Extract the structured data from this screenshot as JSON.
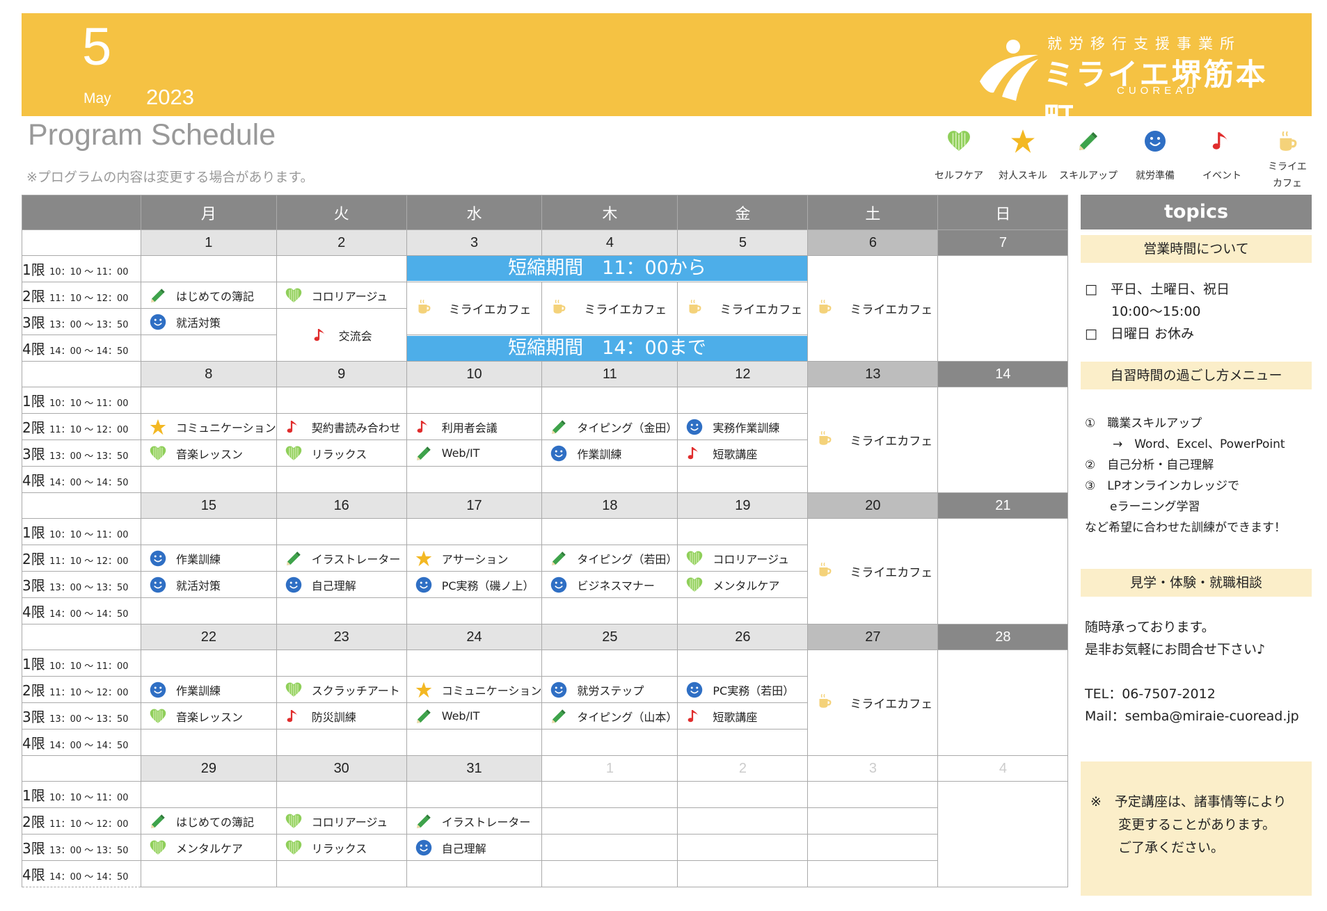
{
  "header": {
    "month_number": "5",
    "month_name": "May",
    "year": "2023",
    "logo": {
      "sub": "就労移行支援事業所",
      "main": "ミライエ堺筋本町",
      "roman": "CUOREAD"
    }
  },
  "title": "Program Schedule",
  "note": "※プログラムの内容は変更する場合があります。",
  "legend": [
    {
      "icon": "heart-icon",
      "label": "セルフケア"
    },
    {
      "icon": "star-icon",
      "label": "対人スキル"
    },
    {
      "icon": "pencil-icon",
      "label": "スキルアップ"
    },
    {
      "icon": "smiley-icon",
      "label": "就労準備"
    },
    {
      "icon": "music-note-icon",
      "label": "イベント"
    },
    {
      "icon": "cup-icon",
      "label_line1": "ミライエ",
      "label_line2": "カフェ"
    }
  ],
  "weekdays": [
    "月",
    "火",
    "水",
    "木",
    "金",
    "土",
    "日"
  ],
  "periods": [
    {
      "name": "1限",
      "time": "10：10 〜 11：00"
    },
    {
      "name": "2限",
      "time": "11：10 〜 12：00"
    },
    {
      "name": "3限",
      "time": "13：00 〜 13：50"
    },
    {
      "name": "4限",
      "time": "14：00 〜 14：50"
    }
  ],
  "cafe_label": "ミライエカフェ",
  "bands": {
    "top": "短縮期間　11：00から",
    "bottom": "短縮期間　14：00まで"
  },
  "weeks": [
    {
      "dates": [
        "1",
        "2",
        "3",
        "4",
        "5",
        "6",
        "7"
      ]
    },
    {
      "dates": [
        "8",
        "9",
        "10",
        "11",
        "12",
        "13",
        "14"
      ]
    },
    {
      "dates": [
        "15",
        "16",
        "17",
        "18",
        "19",
        "20",
        "21"
      ]
    },
    {
      "dates": [
        "22",
        "23",
        "24",
        "25",
        "26",
        "27",
        "28"
      ]
    },
    {
      "dates": [
        "29",
        "30",
        "31",
        "1",
        "2",
        "3",
        "4"
      ]
    }
  ],
  "week1": {
    "mon": [
      {
        "icon": "pencil-icon",
        "label": "はじめての簿記"
      },
      {
        "icon": "smiley-icon",
        "label": "就活対策"
      }
    ],
    "tue_p2": {
      "icon": "heart-icon",
      "label": "コロリアージュ"
    },
    "tue_p34": {
      "icon": "music-note-icon",
      "label": "交流会"
    }
  },
  "week2": {
    "p2": [
      {
        "icon": "star-icon",
        "label": "コミュニケーション"
      },
      {
        "icon": "music-note-icon",
        "label": "契約書読み合わせ"
      },
      {
        "icon": "music-note-icon",
        "label": "利用者会議"
      },
      {
        "icon": "pencil-icon",
        "label": "タイピング（金田）"
      },
      {
        "icon": "smiley-icon",
        "label": "実務作業訓練"
      }
    ],
    "p3": [
      {
        "icon": "heart-icon",
        "label": "音楽レッスン"
      },
      {
        "icon": "heart-icon",
        "label": "リラックス"
      },
      {
        "icon": "pencil-icon",
        "label": "Web/IT"
      },
      {
        "icon": "smiley-icon",
        "label": "作業訓練"
      },
      {
        "icon": "music-note-icon",
        "label": "短歌講座"
      }
    ]
  },
  "week3": {
    "p2": [
      {
        "icon": "smiley-icon",
        "label": "作業訓練"
      },
      {
        "icon": "pencil-icon",
        "label": "イラストレーター"
      },
      {
        "icon": "star-icon",
        "label": "アサーション"
      },
      {
        "icon": "pencil-icon",
        "label": "タイピング（若田）"
      },
      {
        "icon": "heart-icon",
        "label": "コロリアージュ"
      }
    ],
    "p3": [
      {
        "icon": "smiley-icon",
        "label": "就活対策"
      },
      {
        "icon": "smiley-icon",
        "label": "自己理解"
      },
      {
        "icon": "smiley-icon",
        "label": "PC実務（磯ノ上）"
      },
      {
        "icon": "smiley-icon",
        "label": "ビジネスマナー"
      },
      {
        "icon": "heart-icon",
        "label": "メンタルケア"
      }
    ]
  },
  "week4": {
    "p2": [
      {
        "icon": "smiley-icon",
        "label": "作業訓練"
      },
      {
        "icon": "heart-icon",
        "label": "スクラッチアート"
      },
      {
        "icon": "star-icon",
        "label": "コミュニケーション"
      },
      {
        "icon": "smiley-icon",
        "label": "就労ステップ"
      },
      {
        "icon": "smiley-icon",
        "label": "PC実務（若田）"
      }
    ],
    "p3": [
      {
        "icon": "heart-icon",
        "label": "音楽レッスン"
      },
      {
        "icon": "music-note-icon",
        "label": "防災訓練"
      },
      {
        "icon": "pencil-icon",
        "label": "Web/IT"
      },
      {
        "icon": "pencil-icon",
        "label": "タイピング（山本）"
      },
      {
        "icon": "music-note-icon",
        "label": "短歌講座"
      }
    ]
  },
  "week5": {
    "p2": [
      {
        "icon": "pencil-icon",
        "label": "はじめての簿記"
      },
      {
        "icon": "heart-icon",
        "label": "コロリアージュ"
      },
      {
        "icon": "pencil-icon",
        "label": "イラストレーター"
      }
    ],
    "p3": [
      {
        "icon": "heart-icon",
        "label": "メンタルケア"
      },
      {
        "icon": "heart-icon",
        "label": "リラックス"
      },
      {
        "icon": "smiley-icon",
        "label": "自己理解"
      }
    ]
  },
  "topics": {
    "title": "topics",
    "sec1": {
      "title": "営業時間について",
      "line1": "□　平日、土曜日、祝日",
      "line2": "10:00〜15:00",
      "line3": "□　日曜日 お休み"
    },
    "sec2": {
      "title": "自習時間の過ごし方メニュー",
      "line1": "①　職業スキルアップ",
      "line2": "→　Word、Excel、PowerPoint",
      "line3": "②　自己分析・自己理解",
      "line4": "③　LPオンラインカレッジで",
      "line5": "eラーニング学習",
      "line6": "など希望に合わせた訓練ができます！"
    },
    "sec3": {
      "title": "見学・体験・就職相談",
      "line1": "随時承っております。",
      "line2": "是非お気軽にお問合せ下さい♪",
      "tel": "TEL：06-7507-2012",
      "mail": "Mail：semba@miraie-cuoread.jp"
    },
    "note": {
      "line1": "※　予定講座は、諸事情等により",
      "line2": "変更することがあります。",
      "line3": "ご了承ください。"
    }
  },
  "colors": {
    "header": "#f5c243",
    "band": "#4daee9",
    "day_header": "#888888",
    "topic_section": "#fbeec9"
  }
}
